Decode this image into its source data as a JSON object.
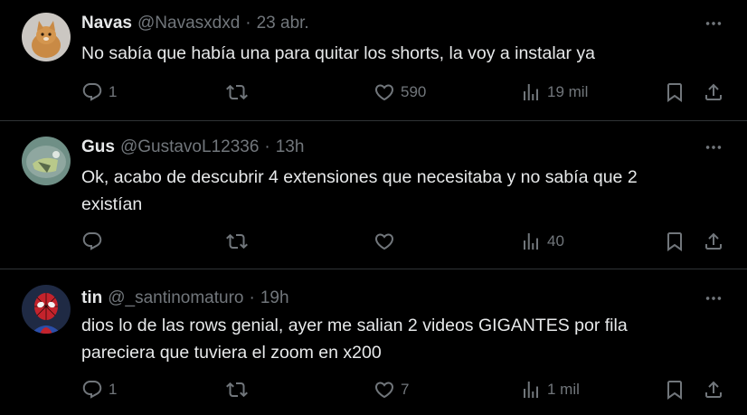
{
  "tweets": [
    {
      "name": "Navas",
      "handle": "@Navasxdxd",
      "separator": "·",
      "time": "23 abr.",
      "text": "No sabía que había una para quitar los shorts, la voy a instalar ya",
      "replies": "1",
      "retweets": "",
      "likes": "590",
      "views": "19 mil"
    },
    {
      "name": "Gus",
      "handle": "@GustavoL12336",
      "separator": "·",
      "time": "13h",
      "text": "Ok, acabo de descubrir 4 extensiones que necesitaba y no sabía que 2 existían",
      "replies": "",
      "retweets": "",
      "likes": "",
      "views": "40"
    },
    {
      "name": "tin",
      "handle": "@_santinomaturo",
      "separator": "·",
      "time": "19h",
      "text": "dios lo de las rows genial, ayer me salian 2 videos GIGANTES por fila pareciera que tuviera el zoom en x200",
      "replies": "1",
      "retweets": "",
      "likes": "7",
      "views": "1 mil"
    }
  ],
  "colors": {
    "background": "#000000",
    "text": "#e7e9ea",
    "secondary": "#71767b",
    "divider": "#2f3336"
  },
  "icons": [
    "reply-icon",
    "retweet-icon",
    "like-icon",
    "views-icon",
    "bookmark-icon",
    "share-icon",
    "more-icon"
  ]
}
